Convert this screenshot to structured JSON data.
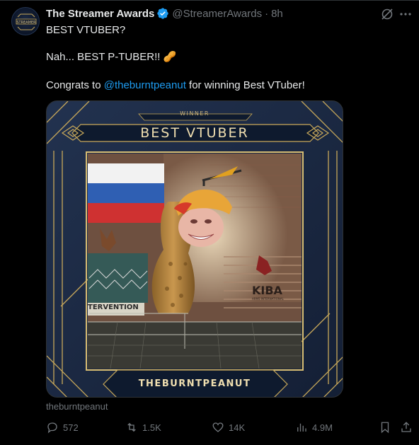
{
  "tweet": {
    "author_name": "The Streamer Awards",
    "handle": "@StreamerAwards",
    "separator": "·",
    "time": "8h",
    "avatar_logo_text": "STREAMER",
    "line1": "BEST VTUBER?",
    "line2": "Nah... BEST P-TUBER!! 🥜",
    "line3_prefix": "Congrats to ",
    "line3_mention": "@theburntpeanut",
    "line3_suffix": " for winning Best VTuber!"
  },
  "media": {
    "winner_label": "WINNER",
    "award_title": "BEST VTUBER",
    "winner_name": "THEBURNTPEANUT",
    "scene_sign_text": "TERVENTION",
    "scene_logo_text": "KIBA",
    "scene_logo_subtext": "ARMS INTERNATIONAL"
  },
  "caption": "theburntpeanut",
  "actions": {
    "replies": "572",
    "reposts": "1.5K",
    "likes": "14K",
    "views": "4.9M"
  },
  "colors": {
    "accent": "#1d9bf0",
    "muted": "#71767b",
    "text": "#e7e9ea",
    "gold": "#c9a95a",
    "navy": "#1a2740"
  }
}
